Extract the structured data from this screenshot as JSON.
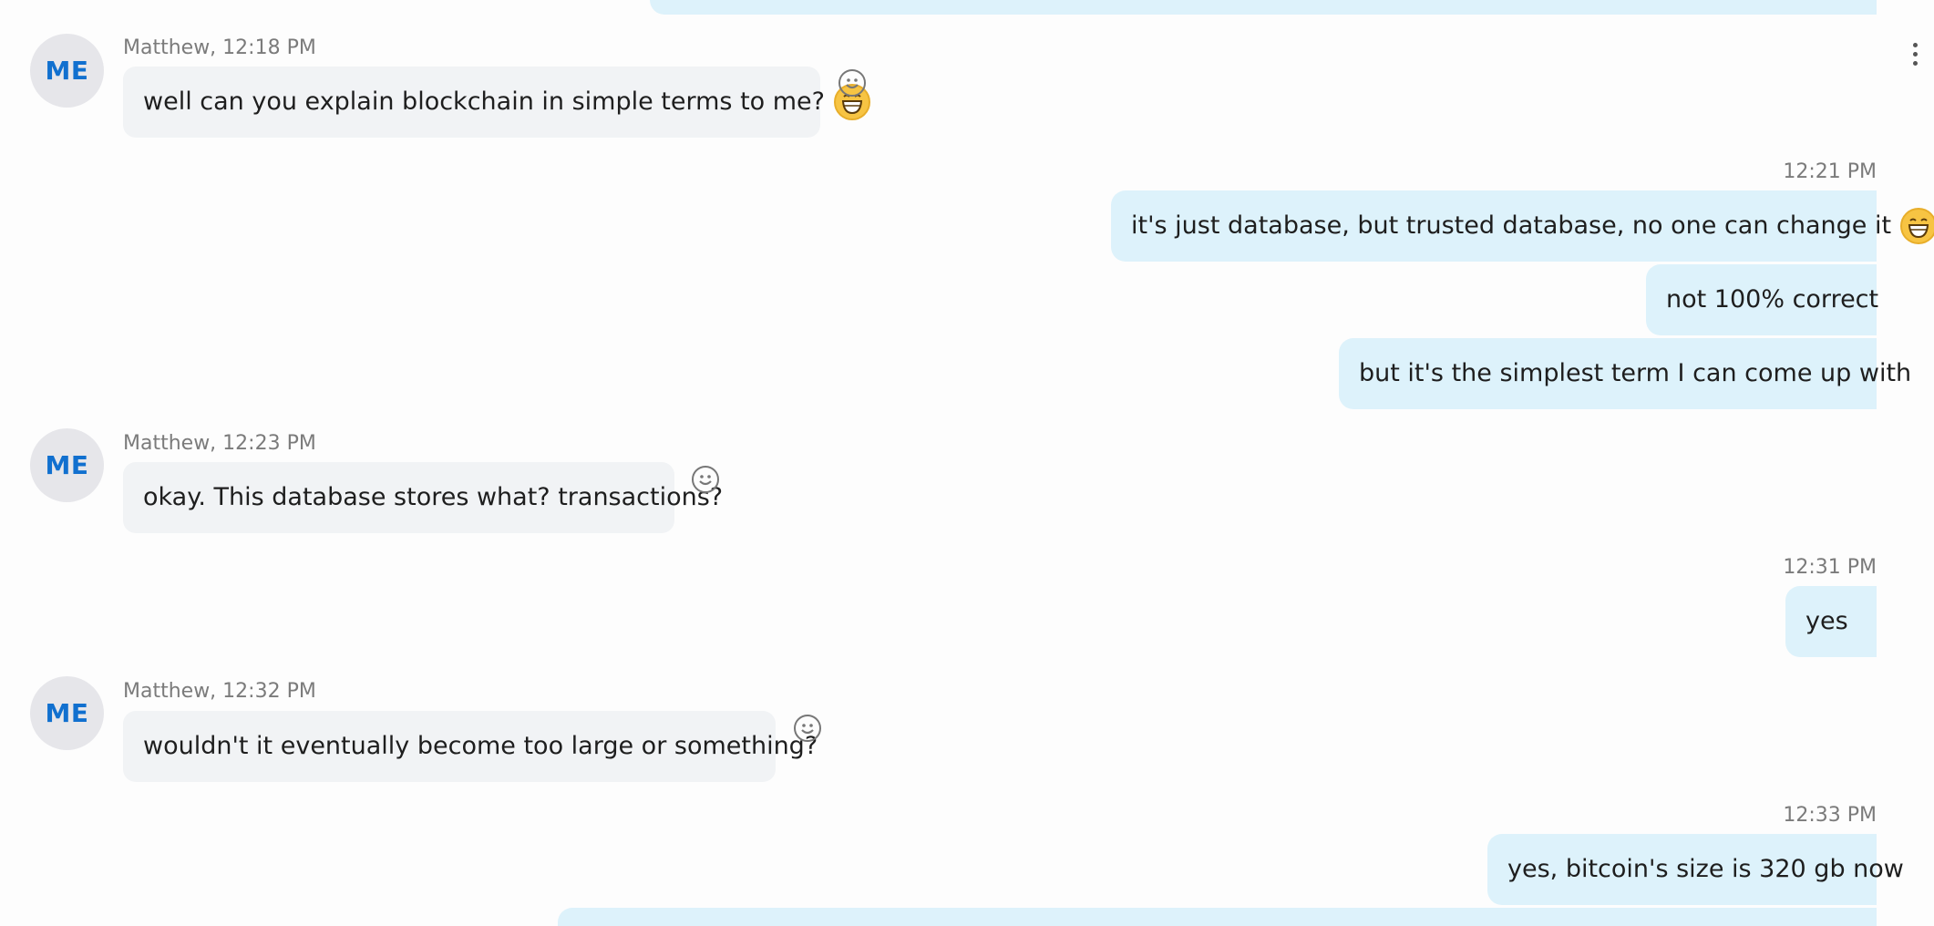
{
  "messages": {
    "m1": {
      "sender": "Matthew, 12:18 PM",
      "avatar": "ME",
      "text": "well can you explain blockchain in simple terms to me?"
    },
    "m2": {
      "time": "12:21 PM",
      "text": "it's just database, but trusted database, no one can change it"
    },
    "m3": {
      "text": "not 100% correct"
    },
    "m4": {
      "text": "but it's the simplest term I can come up with"
    },
    "m5": {
      "sender": "Matthew, 12:23 PM",
      "avatar": "ME",
      "text": "okay. This database stores what? transactions?"
    },
    "m6": {
      "time": "12:31 PM",
      "text": "yes"
    },
    "m7": {
      "sender": "Matthew, 12:32 PM",
      "avatar": "ME",
      "text": "wouldn't it eventually become too large or something?"
    },
    "m8": {
      "time": "12:33 PM",
      "text": "yes, bitcoin's size is 320 gb now"
    }
  },
  "icons": {
    "emoji": "grinning-face-icon",
    "reaction": "smiley-reaction-icon",
    "more": "more-options-icon"
  },
  "colors": {
    "outgoing_bubble": "#ddf2fb",
    "incoming_bubble": "#f1f3f5",
    "avatar_text": "#1170cf"
  }
}
